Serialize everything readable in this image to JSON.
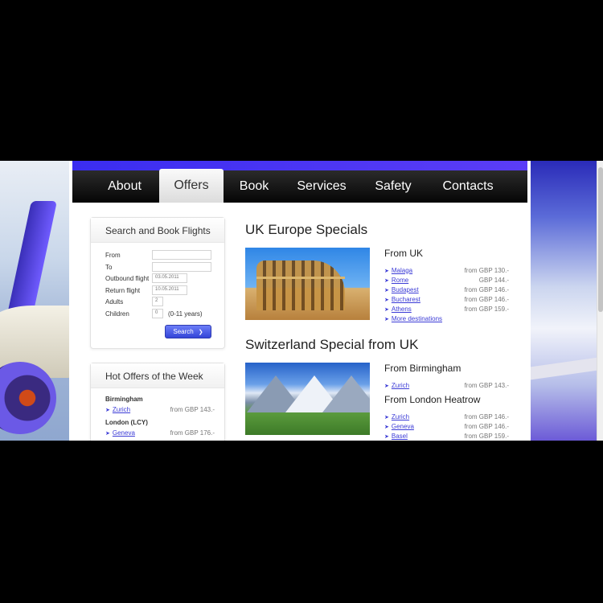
{
  "nav": {
    "items": [
      {
        "label": "About",
        "active": false
      },
      {
        "label": "Offers",
        "active": true
      },
      {
        "label": "Book",
        "active": false
      },
      {
        "label": "Services",
        "active": false
      },
      {
        "label": "Safety",
        "active": false
      },
      {
        "label": "Contacts",
        "active": false
      }
    ]
  },
  "search_box": {
    "title": "Search and Book Flights",
    "from_label": "From",
    "to_label": "To",
    "outbound_label": "Outbound flight",
    "outbound_value": "03.05.2011",
    "return_label": "Return flight",
    "return_value": "10.05.2011",
    "adults_label": "Adults",
    "adults_value": "2",
    "children_label": "Children",
    "children_value": "0",
    "children_note": "(0-11 years)",
    "search_label": "Search"
  },
  "hot_offers": {
    "title": "Hot Offers of the Week",
    "groups": [
      {
        "city": "Birmingham",
        "rows": [
          {
            "dest": "Zurich",
            "price": "from GBP 143.-"
          }
        ]
      },
      {
        "city": "London (LCY)",
        "rows": [
          {
            "dest": "Geneva",
            "price": "from GBP 176.-"
          }
        ]
      }
    ]
  },
  "uk_specials": {
    "title": "UK Europe Specials",
    "from_title": "From UK",
    "rows": [
      {
        "dest": "Malaga",
        "price": "from GBP 130.-"
      },
      {
        "dest": "Rome",
        "price": "GBP 144.-"
      },
      {
        "dest": "Budapest",
        "price": "from GBP 146.-"
      },
      {
        "dest": "Bucharest",
        "price": "from GBP 146.-"
      },
      {
        "dest": "Athens",
        "price": "from GBP 159.-"
      }
    ],
    "more": "More destinations"
  },
  "ch_specials": {
    "title": "Switzerland Special from UK",
    "bham_title": "From Birmingham",
    "bham_rows": [
      {
        "dest": "Zurich",
        "price": "from GBP 143.-"
      }
    ],
    "lhr_title": "From London Heatrow",
    "lhr_rows": [
      {
        "dest": "Zurich",
        "price": "from GBP 146.-"
      },
      {
        "dest": "Geneva",
        "price": "from GBP 146.-"
      },
      {
        "dest": "Basel",
        "price": "from GBP 159.-"
      }
    ]
  },
  "colors": {
    "accent": "#3a2df0",
    "link": "#3b3bd6",
    "nav_bg": "#111111",
    "button": "#4455e6"
  }
}
